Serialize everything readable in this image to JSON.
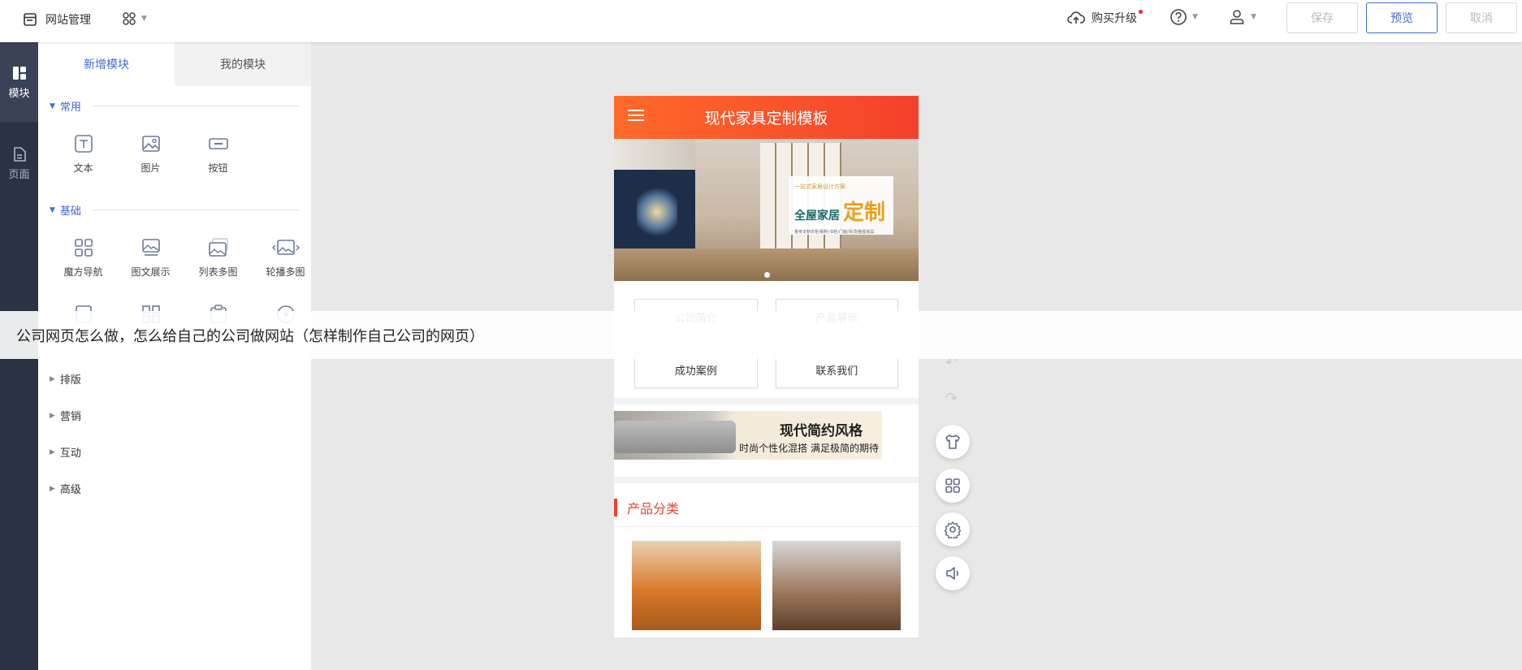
{
  "topbar": {
    "site_label": "网站管理",
    "buy_label": "购买升级",
    "save_label": "保存",
    "preview_label": "预览",
    "cancel_label": "取消"
  },
  "rail": {
    "module_label": "模块",
    "page_label": "页面"
  },
  "panel": {
    "tabs": [
      "新增模块",
      "我的模块"
    ],
    "sections": [
      {
        "title": "常用",
        "items": [
          "文本",
          "图片",
          "按钮"
        ]
      },
      {
        "title": "基础",
        "items": [
          "魔方导航",
          "图文展示",
          "列表多图",
          "轮播多图"
        ]
      }
    ],
    "collapsed_sections": [
      "排版",
      "营销",
      "互动",
      "高级"
    ]
  },
  "banner": {
    "text": "公司网页怎么做，怎么给自己的公司做网站（怎样制作自己公司的网页）"
  },
  "phone": {
    "title": "现代家具定制模板",
    "hero": {
      "small": "一站式家居设计方案",
      "big1": "全屋家居",
      "big2": "定制",
      "tiny": "量身定制衣柜/橱柜/书柜/门窗/吊顶/整屋家具"
    },
    "nav_buttons": [
      "公司简介",
      "产品展示",
      "成功案例",
      "联系我们"
    ],
    "promo": {
      "title": "现代简约风格",
      "subtitle": "时尚个性化混搭 满足极简的期待"
    },
    "category_title": "产品分类"
  },
  "colors": {
    "accent": "#3f6ad8",
    "header_gradient_start": "#ff6a2a",
    "header_gradient_end": "#f4402c",
    "rail_bg": "#2b3244"
  }
}
